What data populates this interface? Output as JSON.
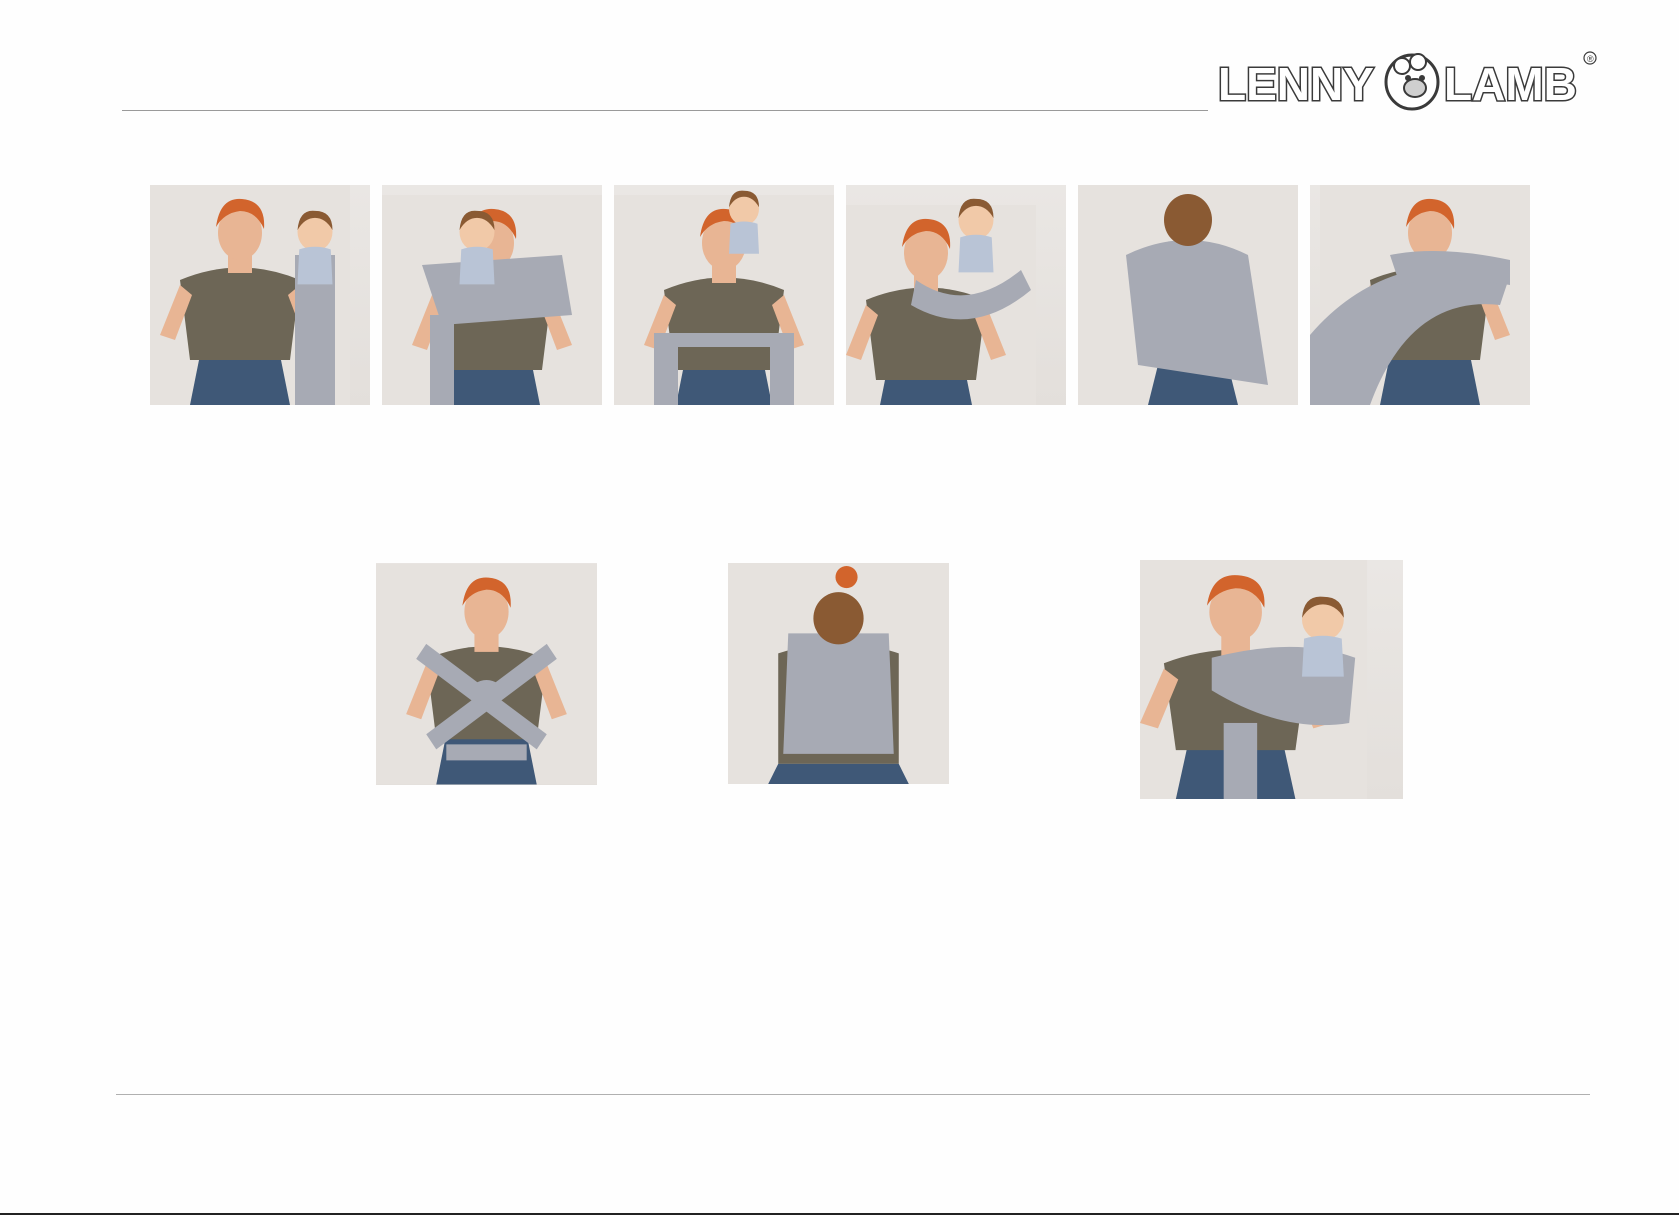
{
  "brand": {
    "logo_left": "LENNY",
    "logo_right": "LAMB",
    "registered": "®",
    "text_color": "#3a3a3a"
  },
  "colors": {
    "background": "#fefefe",
    "rule": "#9a9a9a",
    "wrap_grey": "#a7aab4",
    "shirt": "#6d6656",
    "hair": "#d2642c",
    "jeans": "#3f5877",
    "skin": "#e8b594"
  },
  "steps_top": [
    {
      "name": "step-1-photo"
    },
    {
      "name": "step-2-photo"
    },
    {
      "name": "step-3-photo"
    },
    {
      "name": "step-4-photo"
    },
    {
      "name": "step-5-photo"
    },
    {
      "name": "step-6-photo"
    }
  ],
  "steps_bottom": [
    {
      "name": "step-7-photo"
    },
    {
      "name": "step-8-photo"
    },
    {
      "name": "step-9-photo"
    }
  ]
}
